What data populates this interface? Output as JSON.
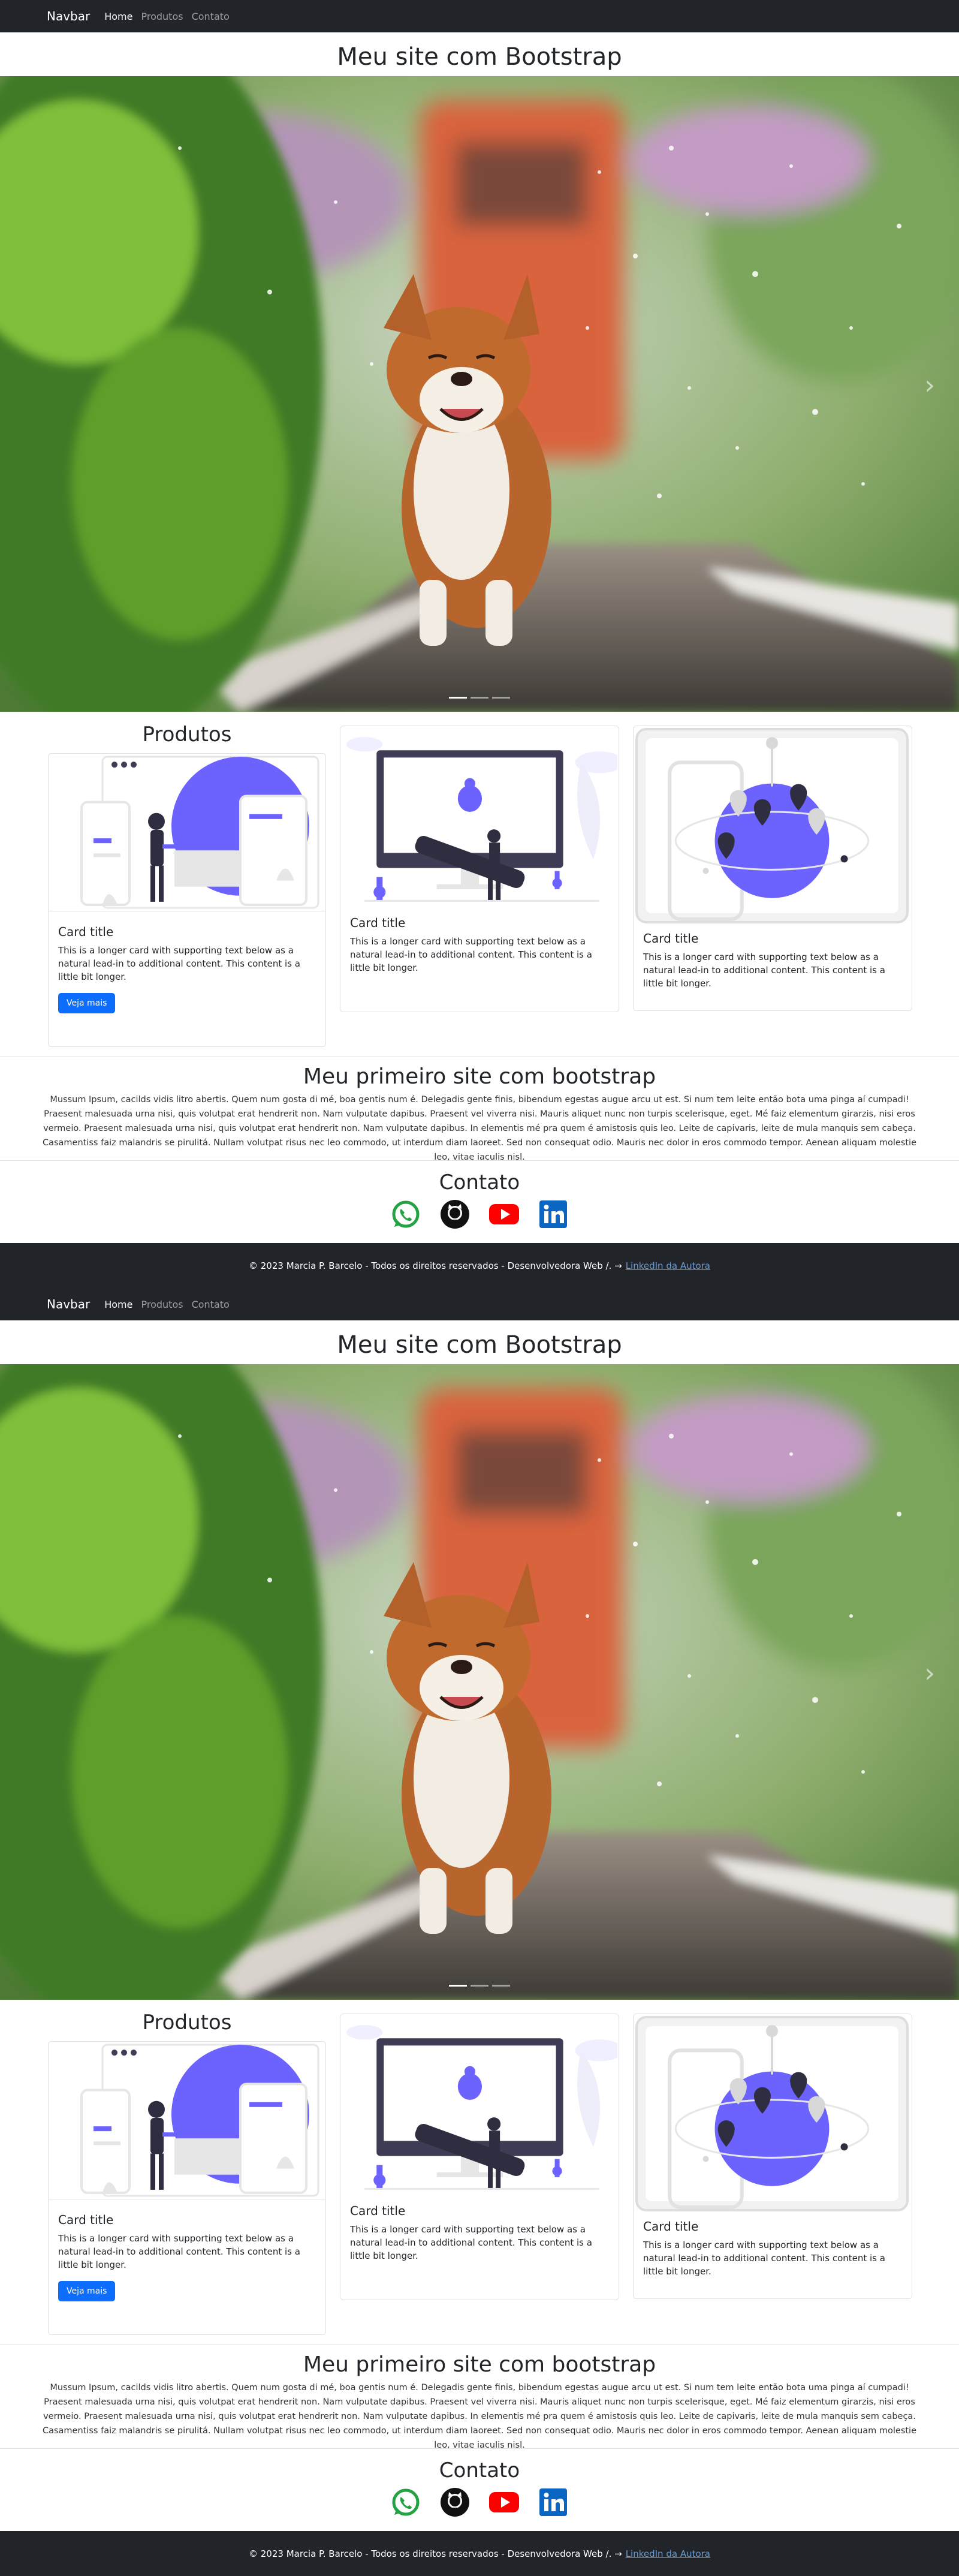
{
  "navbar": {
    "brand": "Navbar",
    "links": [
      "Home",
      "Produtos",
      "Contato"
    ]
  },
  "site_title": "Meu site com Bootstrap",
  "carousel": {
    "image": "corgi dog on railway track",
    "next_icon": "chevron-right-icon",
    "slides": 3,
    "active_slide": 1
  },
  "products": {
    "title": "Produtos",
    "cards": [
      {
        "image": "people-with-phones-illustration",
        "title": "Card title",
        "text": "This is a longer card with supporting text below as a natural lead-in to additional content. This content is a little bit longer.",
        "button": "Veja mais"
      },
      {
        "image": "bug-fixing-monitor-illustration",
        "title": "Card title",
        "text": "This is a longer card with supporting text below as a natural lead-in to additional content. This content is a little bit longer."
      },
      {
        "image": "phone-with-map-pins-illustration",
        "title": "Card title",
        "text": "This is a longer card with supporting text below as a natural lead-in to additional content. This content is a little bit longer."
      }
    ]
  },
  "about": {
    "title": "Meu primeiro site com bootstrap",
    "text": "Mussum Ipsum, cacilds vidis litro abertis. Quem num gosta di mé, boa gentis num é. Delegadis gente finis, bibendum egestas augue arcu ut est. Si num tem leite então bota uma pinga aí cumpadi! Praesent malesuada urna nisi, quis volutpat erat hendrerit non. Nam vulputate dapibus. Praesent vel viverra nisi. Mauris aliquet nunc non turpis scelerisque, eget. Mé faiz elementum girarzis, nisi eros vermeio. Praesent malesuada urna nisi, quis volutpat erat hendrerit non. Nam vulputate dapibus. In elementis mé pra quem é amistosis quis leo. Leite de capivaris, leite de mula manquis sem cabeça. Casamentiss faiz malandris se pirulitá. Nullam volutpat risus nec leo commodo, ut interdum diam laoreet. Sed non consequat odio. Mauris nec dolor in eros commodo tempor. Aenean aliquam molestie leo, vitae iaculis nisl."
  },
  "contact": {
    "title": "Contato",
    "icons": [
      "whatsapp-icon",
      "github-icon",
      "youtube-icon",
      "linkedin-icon"
    ]
  },
  "footer": {
    "text": "© 2023 Marcia P. Barcelo - Todos os direitos reservados - Desenvolvedora Web /. →",
    "link": "LinkedIn da Autora"
  },
  "colors": {
    "navbar_bg": "#212529",
    "primary": "#0d6efd",
    "illustration_accent": "#6c63ff",
    "whatsapp": "#25a244",
    "youtube": "#ff0000",
    "linkedin": "#0a66c2"
  }
}
